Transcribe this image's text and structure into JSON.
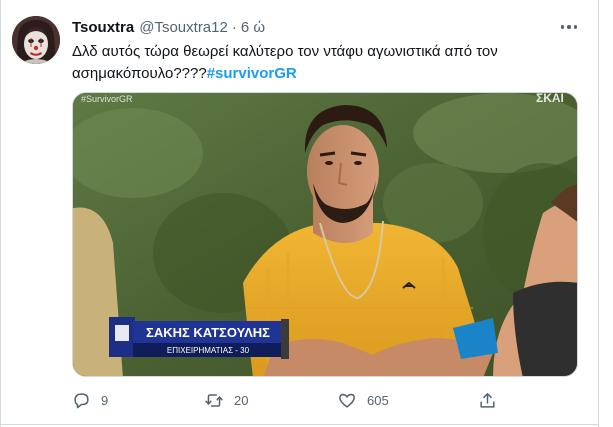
{
  "tweet": {
    "author": {
      "display_name": "Tsouxtra",
      "handle": "@Tsouxtra12",
      "separator": "·",
      "time": "6 ώ",
      "avatar_icon": "clown-face-avatar"
    },
    "text": "Δλδ αυτός τώρα θεωρεί καλύτερο τον ντάφυ αγωνιστικά από τον ασημακόπουλο????",
    "hashtag": "#survivorGR",
    "media": {
      "watermark": "#SurvivorGR",
      "channel_logo": "ΣΚΑΪ",
      "caption_name": "ΣΑΚΗΣ ΚΑΤΣΟΥΛΗΣ",
      "caption_detail": "ΕΠΙΧΕΙΡΗΜΑΤΙΑΣ - 30"
    },
    "actions": {
      "reply": {
        "icon": "reply-icon",
        "count": "9"
      },
      "retweet": {
        "icon": "retweet-icon",
        "count": "20"
      },
      "like": {
        "icon": "heart-icon",
        "count": "605"
      },
      "share": {
        "icon": "share-icon"
      }
    }
  },
  "colors": {
    "text": "#0f1419",
    "secondary": "#536471",
    "link": "#1d9bf0",
    "border": "#cfd9de"
  }
}
